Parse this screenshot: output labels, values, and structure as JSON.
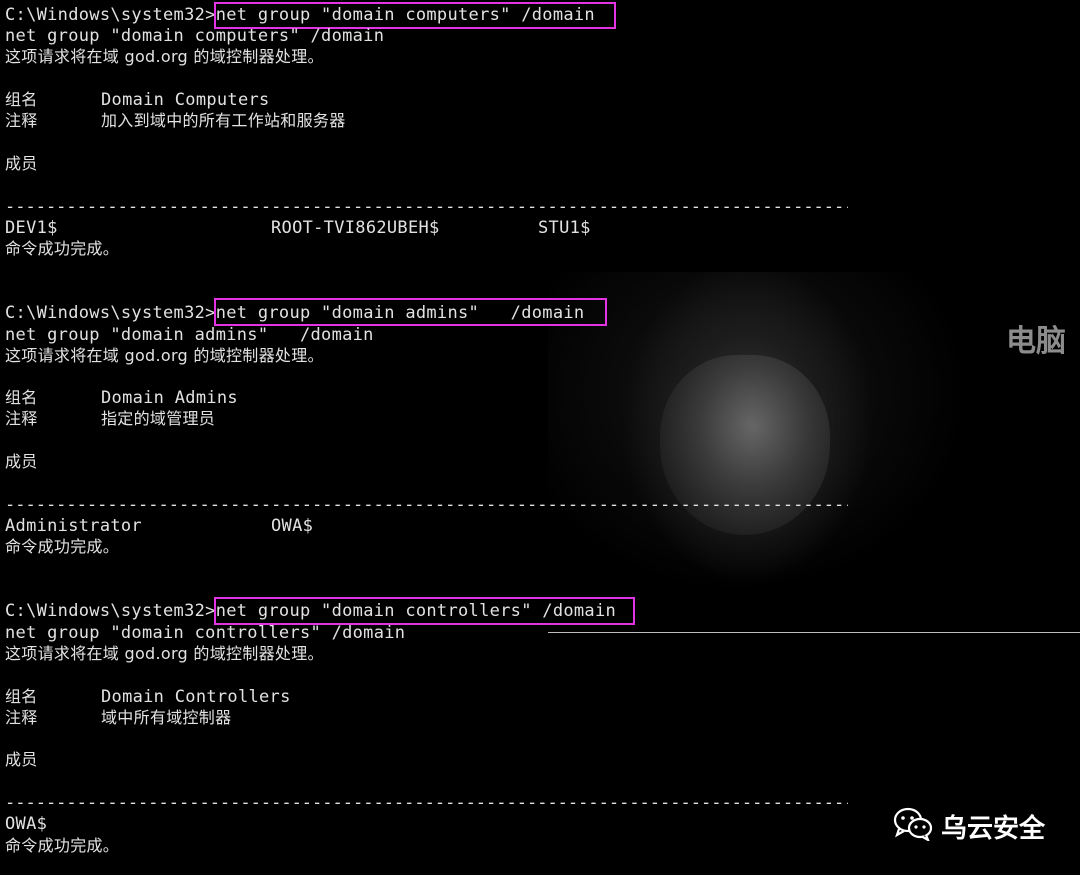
{
  "blocks": [
    {
      "prompt": "C:\\Windows\\system32>",
      "command": "net group \"domain computers\" /domain",
      "echo": "net group \"domain computers\" /domain",
      "request": "这项请求将在域 god.org 的域控制器处理。",
      "group_label": "组名",
      "group_name": "Domain Computers",
      "comment_label": "注释",
      "comment": "加入到域中的所有工作站和服务器",
      "members_label": "成员",
      "members": [
        "DEV1$",
        "ROOT-TVI862UBEH$",
        "STU1$"
      ],
      "done": "命令成功完成。"
    },
    {
      "prompt": "C:\\Windows\\system32>",
      "command": "net group \"domain admins\"   /domain",
      "echo": "net group \"domain admins\"   /domain",
      "request": "这项请求将在域 god.org 的域控制器处理。",
      "group_label": "组名",
      "group_name": "Domain Admins",
      "comment_label": "注释",
      "comment": "指定的域管理员",
      "members_label": "成员",
      "members": [
        "Administrator",
        "OWA$"
      ],
      "done": "命令成功完成。"
    },
    {
      "prompt": "C:\\Windows\\system32>",
      "command": "net group \"domain controllers\" /domain",
      "echo": "net group \"domain controllers\" /domain",
      "request": "这项请求将在域 god.org 的域控制器处理。",
      "group_label": "组名",
      "group_name": "Domain Controllers",
      "comment_label": "注释",
      "comment": "域中所有域控制器",
      "members_label": "成员",
      "members": [
        "OWA$"
      ],
      "done": "命令成功完成。"
    }
  ],
  "separator": "-----------------------------------------------------------------------------------------------",
  "background_text": "电脑",
  "watermark": {
    "icon": "wechat-icon",
    "text": "乌云安全"
  },
  "colors": {
    "text": "#e2e2e2",
    "highlight": "#e234e2",
    "background": "#000000"
  }
}
